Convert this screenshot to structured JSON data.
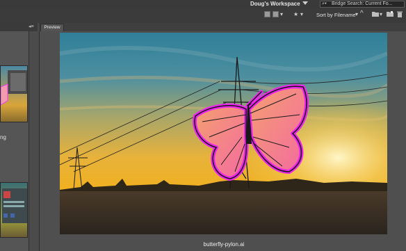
{
  "topbar": {
    "workspace_label": "Doug's Workspace",
    "search_placeholder": "Bridge Search: Current Fo..."
  },
  "toolbar": {
    "sort_label": "Sort by Filename"
  },
  "preview": {
    "tab_label": "Preview",
    "filename": "butterfly-pylon.ai"
  },
  "content": {
    "thumb_label": "ng"
  },
  "icons": {
    "search": "search-icon",
    "view": "view-grid-icon",
    "star": "star-icon",
    "sort_direction": "sort-ascending-icon",
    "folder": "folder-icon",
    "new_folder": "new-folder-icon",
    "delete": "trash-icon"
  },
  "colors": {
    "butterfly_outline": "#ee22ee",
    "butterfly_fill": "#f48aa0",
    "sky_top": "#2f7f98",
    "sun": "#f6c43a"
  }
}
